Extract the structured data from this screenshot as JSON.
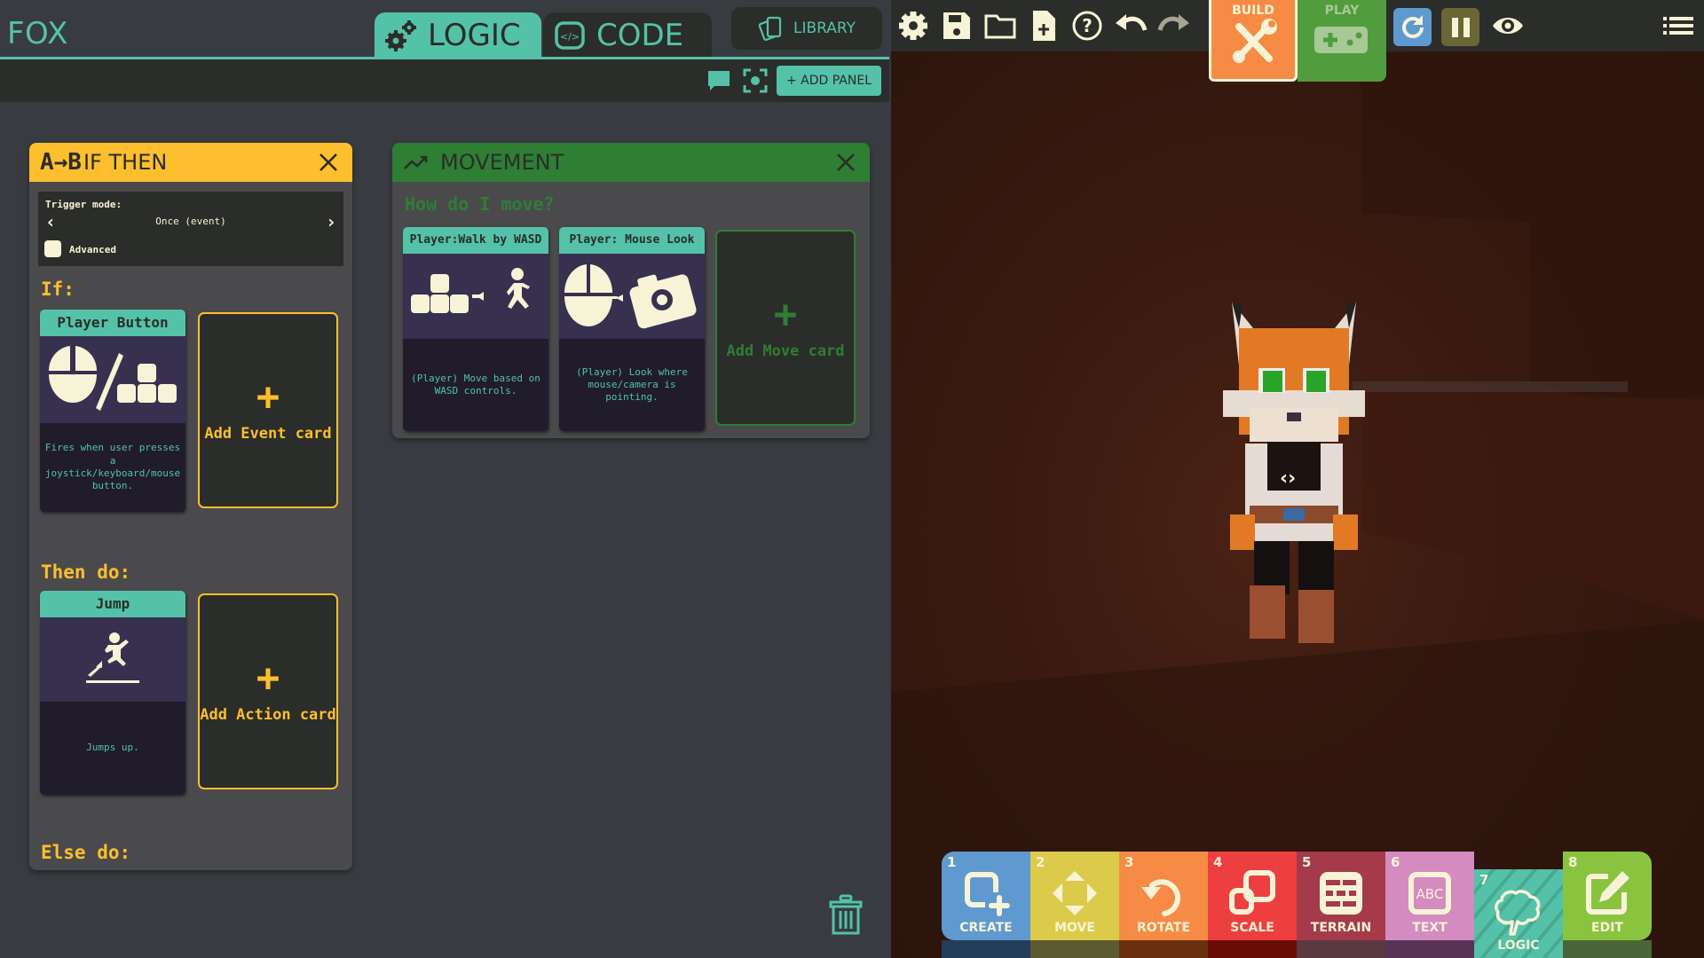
{
  "app": {
    "title": "FOX"
  },
  "editor_tabs": [
    {
      "label": "LOGIC",
      "active": true
    },
    {
      "label": "CODE",
      "active": false
    }
  ],
  "library_button": "LIBRARY",
  "add_panel_button": "+ ADD PANEL",
  "ifthen_panel": {
    "title": "IF THEN",
    "title_prefix": "A→B",
    "trigger_label": "Trigger mode:",
    "trigger_value": "Once (event)",
    "advanced_label": "Advanced",
    "advanced_checked": false,
    "if_label": "If:",
    "then_label": "Then do:",
    "else_label": "Else do:",
    "event_card": {
      "title": "Player Button",
      "description": "Fires when user presses a joystick/keyboard/mouse button."
    },
    "add_event_label": "Add Event card",
    "action_card": {
      "title": "Jump",
      "description": "Jumps up."
    },
    "add_action_label": "Add Action card"
  },
  "movement_panel": {
    "title": "MOVEMENT",
    "question": "How do I move?",
    "cards": [
      {
        "title": "Player:Walk by WASD",
        "description": "(Player) Move based on WASD controls."
      },
      {
        "title": "Player: Mouse Look",
        "description": "(Player) Look where mouse/camera is pointing."
      }
    ],
    "add_label": "Add Move card"
  },
  "game_toolbar": {
    "icons": [
      "settings-icon",
      "save-icon",
      "open-folder-icon",
      "new-file-icon",
      "help-icon",
      "undo-icon",
      "redo-icon"
    ],
    "modes": [
      {
        "label": "BUILD",
        "active": true
      },
      {
        "label": "PLAY",
        "active": false
      }
    ],
    "right_icons": [
      "restart-icon",
      "pause-icon",
      "view-icon",
      "menu-icon"
    ]
  },
  "tools": [
    {
      "num": "1",
      "label": "CREATE",
      "color": "#5e9acf",
      "under": "#233d5a"
    },
    {
      "num": "2",
      "label": "MOVE",
      "color": "#dccb4a",
      "under": "#5c5a30"
    },
    {
      "num": "3",
      "label": "ROTATE",
      "color": "#f58b44",
      "under": "#6a3010"
    },
    {
      "num": "4",
      "label": "SCALE",
      "color": "#ee3f40",
      "under": "#6a0c06"
    },
    {
      "num": "5",
      "label": "TERRAIN",
      "color": "#a43a4a",
      "under": "#5a3a40"
    },
    {
      "num": "6",
      "label": "TEXT",
      "color": "#d48bc0",
      "under": "#583356"
    },
    {
      "num": "7",
      "label": "LOGIC",
      "color": "#54c2a8",
      "under": "#54c2a8",
      "active": true
    },
    {
      "num": "8",
      "label": "EDIT",
      "color": "#8ac43f",
      "under": "#4a6638"
    }
  ],
  "colors": {
    "accent": "#54c2a8",
    "ifthen": "#fdbf2d",
    "movement": "#2e7e33",
    "cream": "#f7f3d6"
  }
}
